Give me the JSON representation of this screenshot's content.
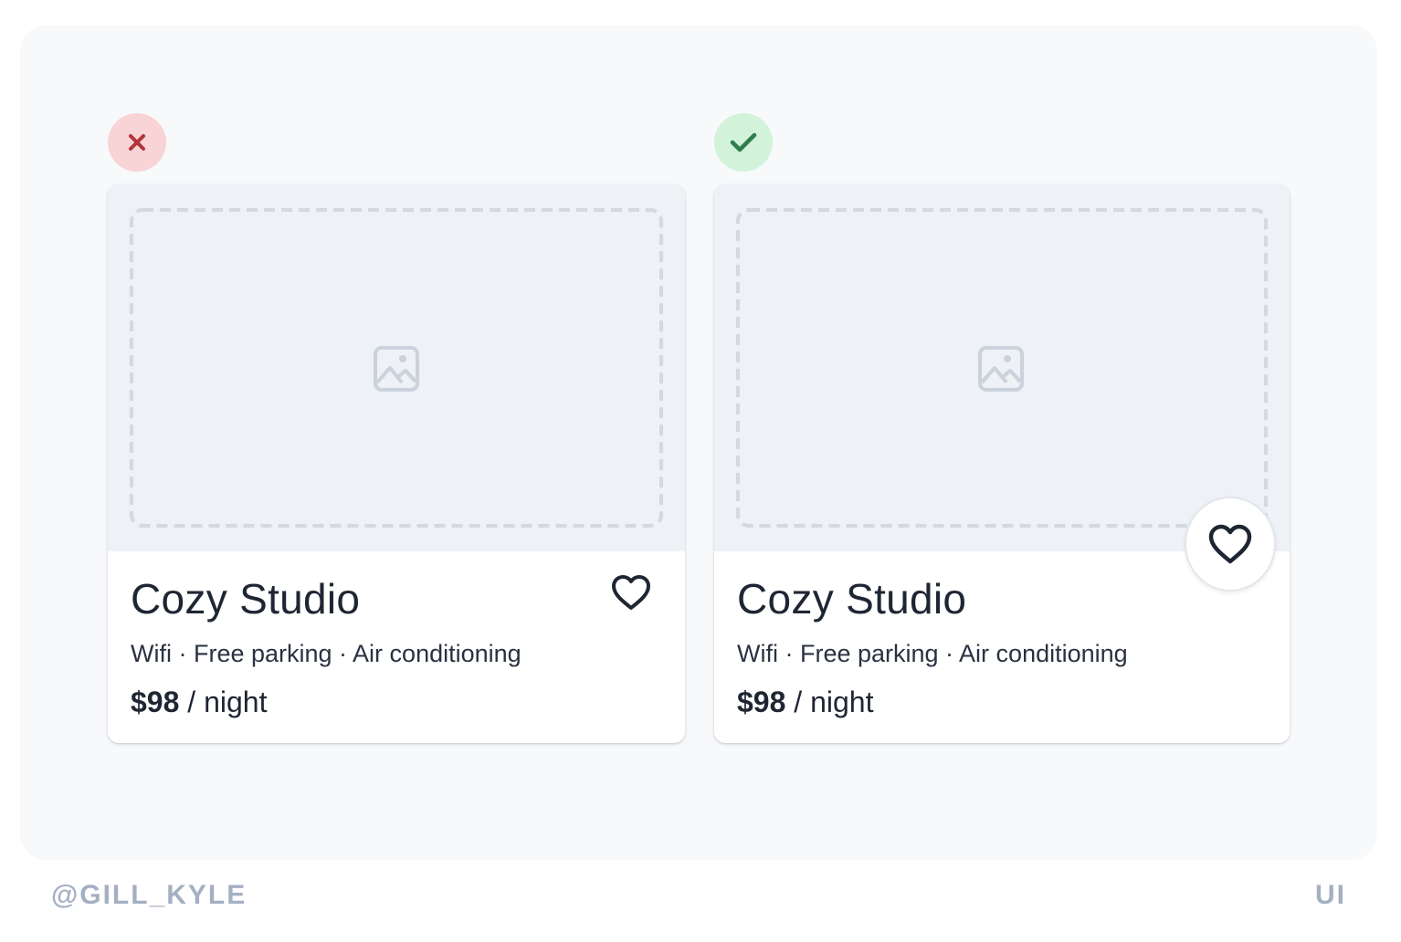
{
  "verdicts": {
    "bad": {
      "icon": "x-mark-icon",
      "color": "#b3343a",
      "background": "#f8d4d6"
    },
    "good": {
      "icon": "check-mark-icon",
      "color": "#2e7d4c",
      "background": "#d2f2da"
    }
  },
  "cards": [
    {
      "variant": "bad",
      "image_placeholder_icon": "image-icon",
      "title": "Cozy Studio",
      "amenities": "Wifi · Free parking · Air conditioning",
      "price": "$98",
      "price_unit": " / night",
      "favorite_icon": "heart-icon"
    },
    {
      "variant": "good",
      "image_placeholder_icon": "image-icon",
      "title": "Cozy Studio",
      "amenities": "Wifi · Free parking · Air conditioning",
      "price": "$98",
      "price_unit": " / night",
      "favorite_icon": "heart-icon"
    }
  ],
  "footer": {
    "handle": "@GILL_KYLE",
    "tag": "UI"
  }
}
